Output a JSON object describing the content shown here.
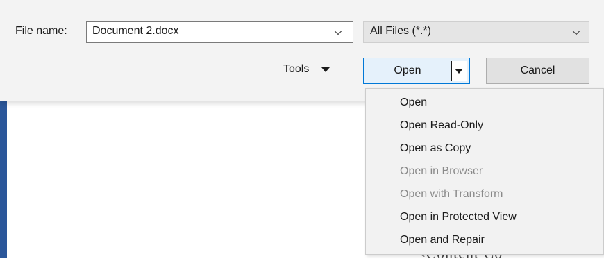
{
  "file_name": {
    "label": "File name:",
    "value": "Document 2.docx"
  },
  "file_type": {
    "selected": "All Files (*.*)"
  },
  "tools_label": "Tools",
  "open_button_label": "Open",
  "cancel_button_label": "Cancel",
  "open_menu": {
    "items": [
      {
        "label": "Open",
        "enabled": true
      },
      {
        "label": "Open Read-Only",
        "enabled": true
      },
      {
        "label": "Open as Copy",
        "enabled": true
      },
      {
        "label": "Open in Browser",
        "enabled": false
      },
      {
        "label": "Open with Transform",
        "enabled": false
      },
      {
        "label": "Open in Protected View",
        "enabled": true
      },
      {
        "label": "Open and Repair",
        "enabled": true
      }
    ]
  },
  "background_doc_text": "<Content Co",
  "colors": {
    "accent_border": "#0078d7",
    "word_blue": "#2b579a",
    "disabled_text": "#8a8a8a"
  }
}
